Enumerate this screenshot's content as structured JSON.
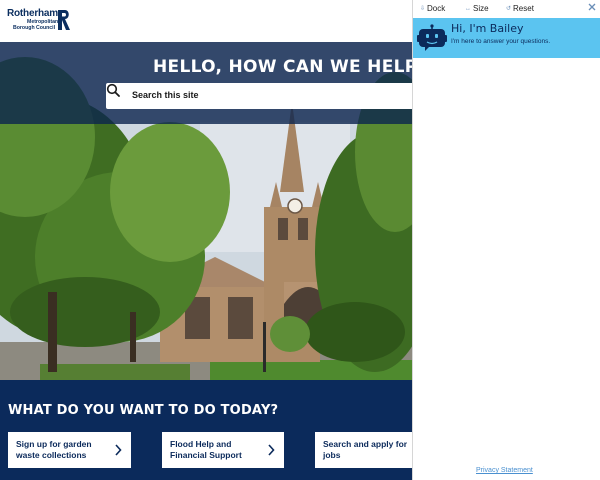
{
  "site": {
    "logo": {
      "word": "Rotherham",
      "line1": "Metropolitan",
      "line2": "Borough Council"
    },
    "colors": {
      "navy": "#0b2a5b",
      "white": "#ffffff"
    }
  },
  "hero": {
    "title": "HELLO, HOW CAN WE HELP Y",
    "search": {
      "placeholder": "Search this site",
      "icon": "search-icon"
    }
  },
  "tasks": {
    "heading": "WHAT DO YOU WANT TO DO TODAY?",
    "items": [
      {
        "label": "Sign up for garden waste collections",
        "icon": "chevron-right-icon"
      },
      {
        "label": "Flood Help and Financial Support",
        "icon": "chevron-right-icon"
      },
      {
        "label": "Search and apply for jobs",
        "icon": "chevron-right-icon"
      }
    ]
  },
  "chat": {
    "toolbar": {
      "dock": {
        "label": "Dock",
        "icon": "dock-icon"
      },
      "size": {
        "label": "Size",
        "icon": "resize-icon"
      },
      "reset": {
        "label": "Reset",
        "icon": "reset-icon"
      },
      "close_icon": "close-icon"
    },
    "greeting": "Hi, I'm Bailey",
    "subtitle": "I'm here to answer your questions.",
    "privacy_link": "Privacy Statement",
    "colors": {
      "banner": "#5bc4f0",
      "link": "#4a90d0"
    }
  }
}
